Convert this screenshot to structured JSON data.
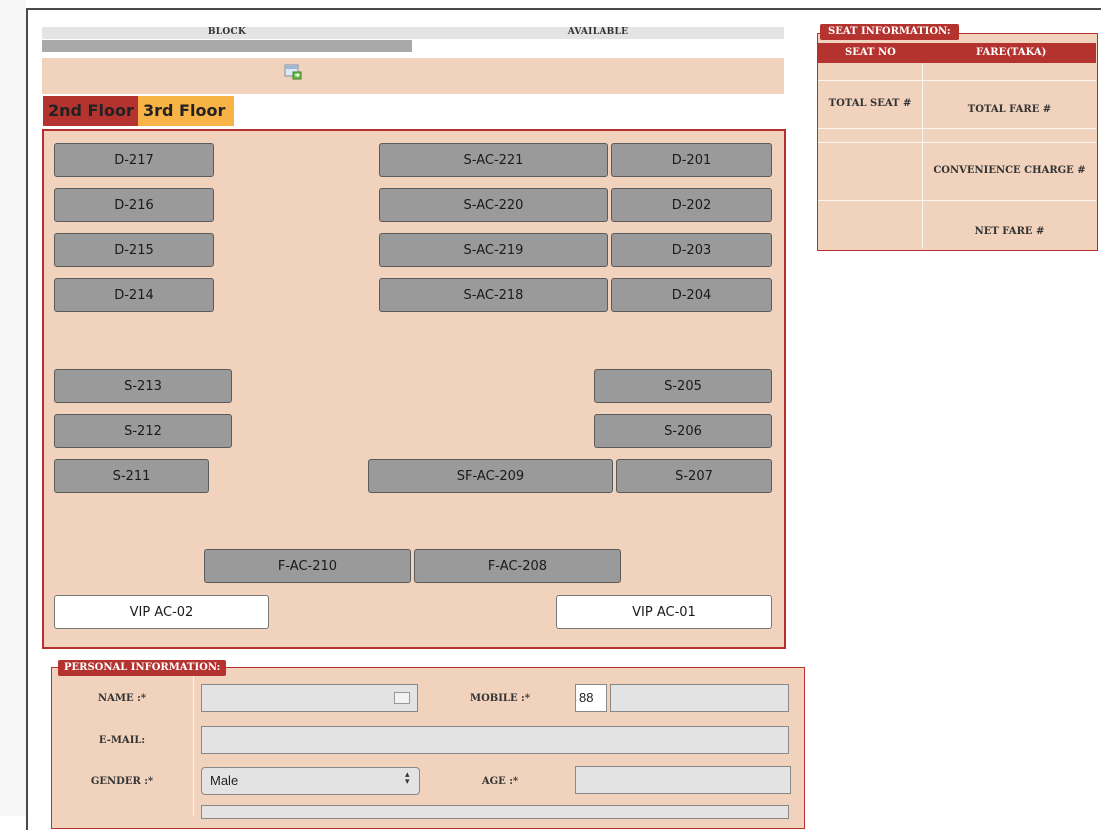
{
  "legend": {
    "block_label": "BLOCK",
    "available_label": "AVAILABLE"
  },
  "floors": {
    "active": "2nd Floor",
    "inactive": "3rd Floor"
  },
  "seats": {
    "d217": "D-217",
    "d216": "D-216",
    "d215": "D-215",
    "d214": "D-214",
    "sac221": "S-AC-221",
    "sac220": "S-AC-220",
    "sac219": "S-AC-219",
    "sac218": "S-AC-218",
    "d201": "D-201",
    "d202": "D-202",
    "d203": "D-203",
    "d204": "D-204",
    "s213": "S-213",
    "s212": "S-212",
    "s211": "S-211",
    "s205": "S-205",
    "s206": "S-206",
    "s207": "S-207",
    "sfac209": "SF-AC-209",
    "fac210": "F-AC-210",
    "fac208": "F-AC-208",
    "vip02": "VIP AC-02",
    "vip01": "VIP AC-01"
  },
  "seat_info": {
    "legend": "SEAT INFORMATION:",
    "col_seat": "SEAT NO",
    "col_fare": "FARE(TAKA)",
    "total_seat": "TOTAL SEAT #",
    "total_fare": "TOTAL FARE #",
    "convenience": "CONVENIENCE CHARGE #",
    "net_fare": "NET FARE #"
  },
  "personal": {
    "legend": "PERSONAL INFORMATION:",
    "name_label": "NAME :*",
    "mobile_label": "MOBILE :*",
    "mobile_prefix": "88",
    "email_label": "E-MAIL:",
    "gender_label": "GENDER :*",
    "gender_value": "Male",
    "age_label": "AGE :*"
  },
  "colors": {
    "accent": "#b5332f",
    "panel_bg": "#f0d2bd",
    "seat_available": "#9a9a9a",
    "seat_vip": "#ffffff",
    "tab_inactive": "#f8b347"
  }
}
